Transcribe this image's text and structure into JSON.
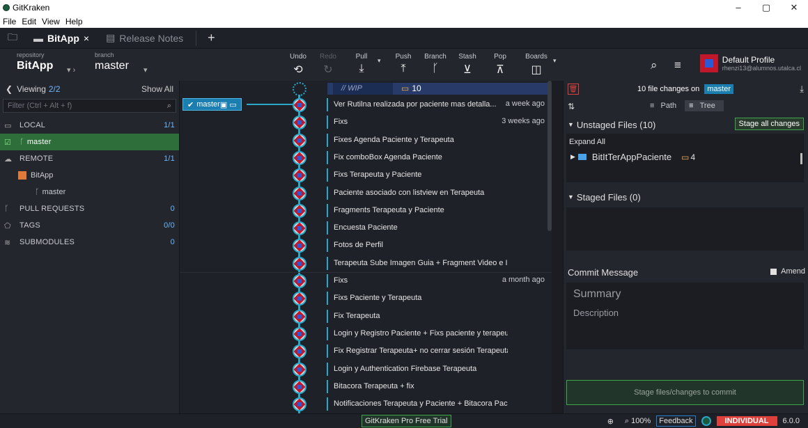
{
  "window": {
    "title": "GitKraken",
    "controls": [
      "–",
      "▢",
      "✕"
    ]
  },
  "menu": [
    "File",
    "Edit",
    "View",
    "Help"
  ],
  "tabs": [
    {
      "label": "BitApp",
      "close": "×",
      "icon": "folder-icon"
    },
    {
      "label": "Release Notes",
      "icon": "doc-icon"
    }
  ],
  "tab_add": "+",
  "toolbar": {
    "repo_label": "repository",
    "repo_value": "BitApp",
    "branch_label": "branch",
    "branch_value": "master",
    "buttons": [
      {
        "label": "Undo",
        "glyph": "⟲"
      },
      {
        "label": "Redo",
        "glyph": "↻"
      },
      {
        "label": "Pull",
        "glyph": "⤓"
      },
      {
        "label": "Push",
        "glyph": "⤒"
      },
      {
        "label": "Branch",
        "glyph": "ᚴ"
      },
      {
        "label": "Stash",
        "glyph": "⊻"
      },
      {
        "label": "Pop",
        "glyph": "⊼"
      },
      {
        "label": "Boards",
        "glyph": "◫"
      }
    ],
    "profile_name": "Default Profile",
    "profile_email": "rhenzi13@alumnos.utalca.cl"
  },
  "left": {
    "viewing": "Viewing",
    "viewing_count": "2/2",
    "show_all": "Show All",
    "filter_placeholder": "Filter (Ctrl + Alt + f)",
    "local": "LOCAL",
    "local_count": "1/1",
    "local_branch": "master",
    "remote": "REMOTE",
    "remote_count": "1/1",
    "remote_repo": "BitApp",
    "remote_branch": "master",
    "pull_requests": "PULL REQUESTS",
    "pull_requests_count": "0",
    "tags": "TAGS",
    "tags_count": "0/0",
    "submodules": "SUBMODULES",
    "submodules_count": "0"
  },
  "graph": {
    "wip_label": "// WIP",
    "wip_count": "10",
    "branch_pill": "master",
    "commits": [
      {
        "msg": "Ver Rutilna realizada por paciente mas detalla...",
        "time": "a week ago"
      },
      {
        "msg": "Fixs",
        "time": "3 weeks ago"
      },
      {
        "msg": "Fixes Agenda Paciente y Terapeuta",
        "time": ""
      },
      {
        "msg": "Fix comboBox Agenda Paciente",
        "time": ""
      },
      {
        "msg": "Fixs Terapeuta y Paciente",
        "time": ""
      },
      {
        "msg": "Paciente asociado con listview en Terapeuta",
        "time": ""
      },
      {
        "msg": "Fragments Terapeuta y Paciente",
        "time": ""
      },
      {
        "msg": "Encuesta Paciente",
        "time": ""
      },
      {
        "msg": "Fotos de Perfil",
        "time": ""
      },
      {
        "msg": "Terapeuta Sube Imagen Guia + Fragment Video e Imagen",
        "time": ""
      },
      {
        "msg": "Fixs",
        "time": "a month ago"
      },
      {
        "msg": "Fixs Paciente y Terapeuta",
        "time": ""
      },
      {
        "msg": "Fix Terapeuta",
        "time": ""
      },
      {
        "msg": "Login y Registro Paciente + Fixs paciente y terapeuta",
        "time": ""
      },
      {
        "msg": "Fix Registrar Terapeuta+ no cerrar sesión Terapeuta",
        "time": ""
      },
      {
        "msg": "Login y Authentication Firebase Terapeuta",
        "time": ""
      },
      {
        "msg": "Bitacora Terapeuta + fix",
        "time": ""
      },
      {
        "msg": "Notificaciones Terapeuta y Paciente + Bitacora Paciente",
        "time": ""
      }
    ]
  },
  "right": {
    "changes_text": "10 file changes on",
    "branch": "master",
    "path_label": "Path",
    "tree_label": "Tree",
    "unstaged": "Unstaged Files (10)",
    "stage_all": "Stage all changes",
    "expand_all": "Expand All",
    "folder": "BitItTerAppPaciente",
    "folder_count": "4",
    "staged": "Staged Files (0)",
    "commit_message": "Commit Message",
    "amend": "Amend",
    "summary": "Summary",
    "description": "Description",
    "stage_btn": "Stage files/changes to commit"
  },
  "status": {
    "trial": "GitKraken Pro Free Trial",
    "zoom": "100%",
    "feedback": "Feedback",
    "plan": "INDIVIDUAL",
    "version": "6.0.0"
  }
}
